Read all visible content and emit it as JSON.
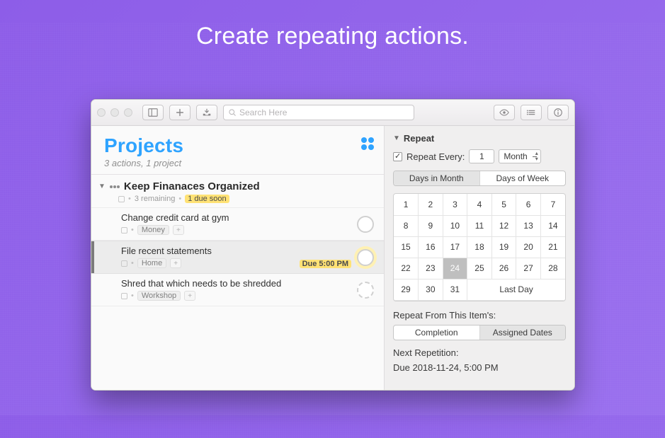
{
  "headline": "Create repeating actions.",
  "toolbar": {
    "search_placeholder": "Search Here"
  },
  "left": {
    "title": "Projects",
    "subtitle": "3 actions, 1 project",
    "project": {
      "title": "Keep Finanaces Organized",
      "remaining": "3 remaining",
      "due_soon": "1 due soon"
    },
    "actions": [
      {
        "title": "Change credit card at gym",
        "tag": "Money",
        "selected": false,
        "circle_style": "solid",
        "due": ""
      },
      {
        "title": "File recent statements",
        "tag": "Home",
        "selected": true,
        "circle_style": "highlight",
        "due": "Due 5:00 PM"
      },
      {
        "title": "Shred that which needs to be shredded",
        "tag": "Workshop",
        "selected": false,
        "circle_style": "dashed",
        "due": ""
      }
    ]
  },
  "right": {
    "section": "Repeat",
    "every_label": "Repeat Every:",
    "every_value": "1",
    "unit": "Month",
    "seg1": [
      "Days in Month",
      "Days of Week"
    ],
    "seg1_active": 0,
    "days": [
      1,
      2,
      3,
      4,
      5,
      6,
      7,
      8,
      9,
      10,
      11,
      12,
      13,
      14,
      15,
      16,
      17,
      18,
      19,
      20,
      21,
      22,
      23,
      24,
      25,
      26,
      27,
      28,
      29,
      30,
      31
    ],
    "selected_day": 24,
    "last_day_label": "Last Day",
    "from_label": "Repeat From This Item's:",
    "seg2": [
      "Completion",
      "Assigned Dates"
    ],
    "seg2_active": 1,
    "next_label": "Next Repetition:",
    "next_value": "Due 2018-11-24, 5:00 PM"
  }
}
